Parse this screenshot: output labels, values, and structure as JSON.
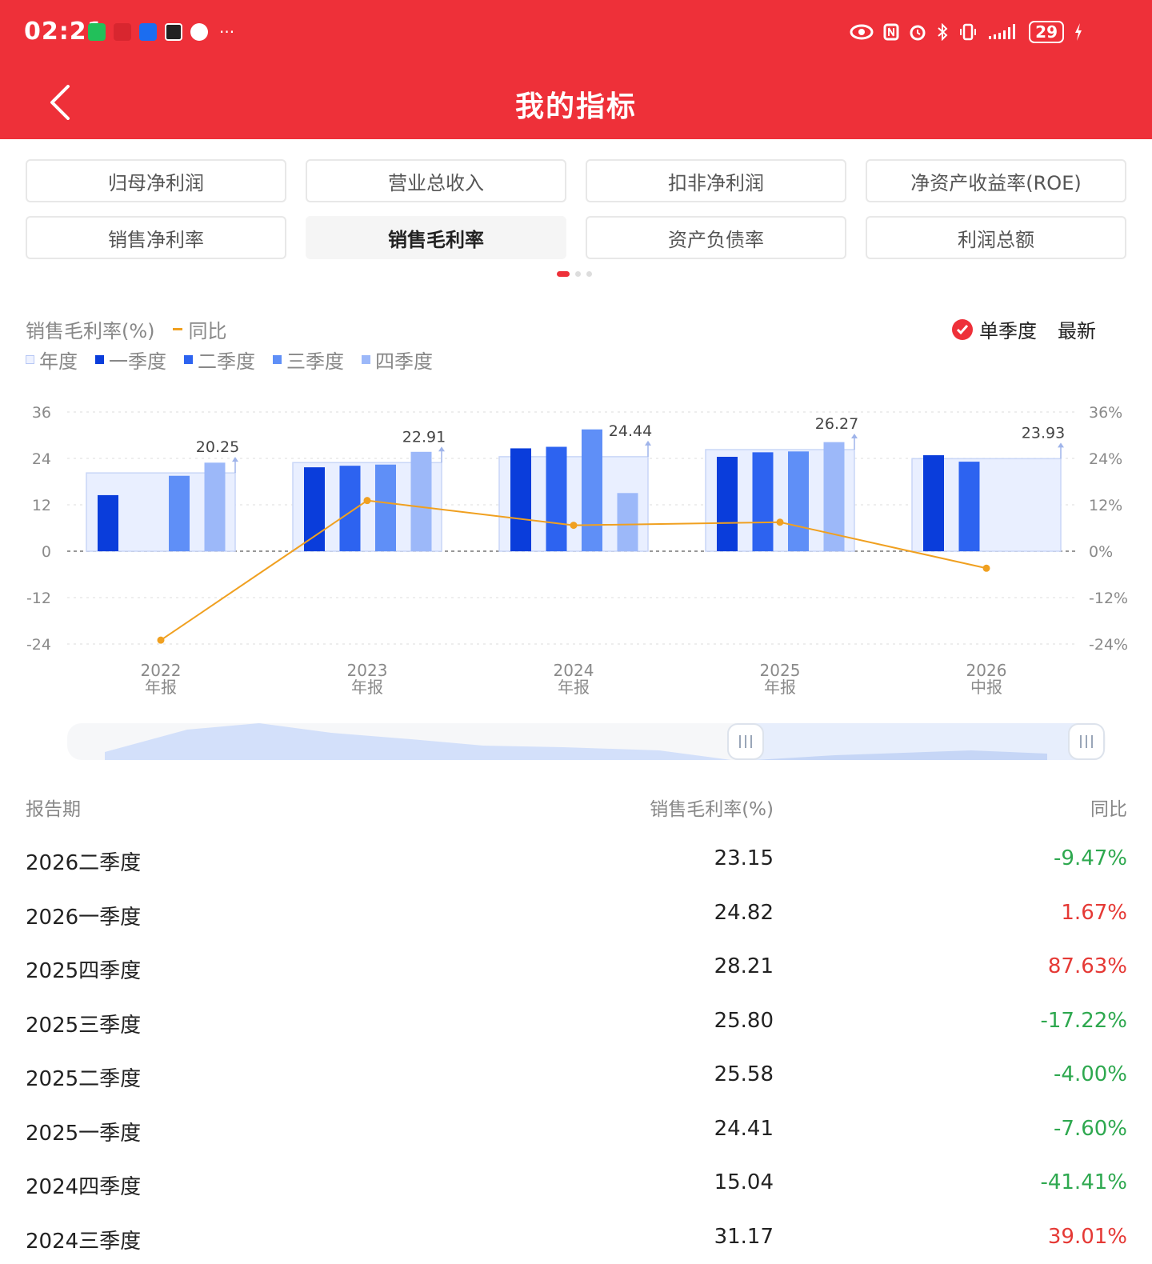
{
  "status_bar": {
    "time": "02:21",
    "more": "···",
    "battery": "29"
  },
  "header": {
    "title": "我的指标"
  },
  "metrics": [
    {
      "label": "归母净利润",
      "active": false
    },
    {
      "label": "营业总收入",
      "active": false
    },
    {
      "label": "扣非净利润",
      "active": false
    },
    {
      "label": "净资产收益率(ROE)",
      "active": false
    },
    {
      "label": "销售净利率",
      "active": false
    },
    {
      "label": "销售毛利率",
      "active": true
    },
    {
      "label": "资产负债率",
      "active": false
    },
    {
      "label": "利润总额",
      "active": false
    }
  ],
  "legend": {
    "metric": "销售毛利率(%)",
    "yoy": "同比",
    "annual": "年度",
    "q1": "一季度",
    "q2": "二季度",
    "q3": "三季度",
    "q4": "四季度"
  },
  "controls": {
    "single_season": "单季度",
    "latest": "最新"
  },
  "colors": {
    "brand_red": "#ee3039",
    "q1": "#0a3ddb",
    "q2": "#2d63f0",
    "q3": "#5f8ff7",
    "q4": "#9cb8f9",
    "annual_fill": "#e9efff",
    "yoy_line": "#f0a020",
    "positive": "#e53935",
    "negative": "#2ea84f"
  },
  "chart_data": {
    "type": "bar",
    "categories": [
      "2022\n年报",
      "2023\n年报",
      "2024\n年报",
      "2025\n年报",
      "2026\n中报"
    ],
    "left_axis": {
      "ticks": [
        "36",
        "24",
        "12",
        "0",
        "-12",
        "-24"
      ],
      "range": [
        -24,
        36
      ]
    },
    "right_axis": {
      "ticks": [
        "36%",
        "24%",
        "12%",
        "0%",
        "-12%",
        "-24%"
      ],
      "range": [
        -24,
        36
      ]
    },
    "annual": [
      20.25,
      22.91,
      24.44,
      26.27,
      23.93
    ],
    "annual_labels": [
      "20.25",
      "22.91",
      "24.44",
      "26.27",
      "23.93"
    ],
    "series": [
      {
        "name": "一季度",
        "values": [
          14.5,
          21.7,
          26.6,
          24.41,
          24.82
        ]
      },
      {
        "name": "二季度",
        "values": [
          null,
          22.1,
          27.0,
          25.58,
          23.15
        ]
      },
      {
        "name": "三季度",
        "values": [
          19.5,
          22.4,
          31.5,
          25.8,
          null
        ]
      },
      {
        "name": "四季度",
        "values": [
          22.9,
          25.7,
          15.04,
          28.21,
          null
        ]
      }
    ],
    "yoy": [
      -23.0,
      13.1,
      6.7,
      7.5,
      -4.4
    ]
  },
  "table": {
    "headers": {
      "period": "报告期",
      "value": "销售毛利率(%)",
      "yoy": "同比"
    },
    "rows": [
      {
        "period": "2026二季度",
        "value": "23.15",
        "yoy": "-9.47%",
        "sign": "neg"
      },
      {
        "period": "2026一季度",
        "value": "24.82",
        "yoy": "1.67%",
        "sign": "pos"
      },
      {
        "period": "2025四季度",
        "value": "28.21",
        "yoy": "87.63%",
        "sign": "pos"
      },
      {
        "period": "2025三季度",
        "value": "25.80",
        "yoy": "-17.22%",
        "sign": "neg"
      },
      {
        "period": "2025二季度",
        "value": "25.58",
        "yoy": "-4.00%",
        "sign": "neg"
      },
      {
        "period": "2025一季度",
        "value": "24.41",
        "yoy": "-7.60%",
        "sign": "neg"
      },
      {
        "period": "2024四季度",
        "value": "15.04",
        "yoy": "-41.41%",
        "sign": "neg"
      },
      {
        "period": "2024三季度",
        "value": "31.17",
        "yoy": "39.01%",
        "sign": "pos"
      }
    ]
  }
}
